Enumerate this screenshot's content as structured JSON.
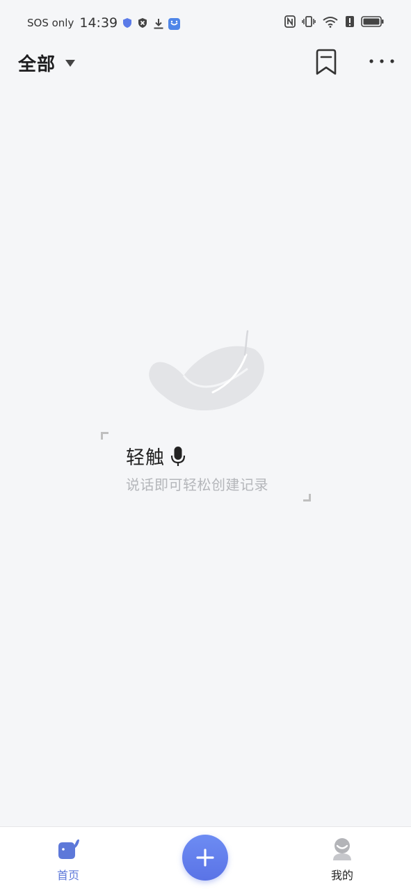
{
  "status_bar": {
    "carrier": "SOS only",
    "time": "14:39",
    "icons": [
      "shield-icon",
      "blocked-icon",
      "download-icon",
      "app-notification-icon",
      "nfc-icon",
      "vibrate-icon",
      "wifi-icon",
      "alert-icon",
      "battery-icon"
    ]
  },
  "header": {
    "filter_label": "全部",
    "icons": [
      "dropdown-caret-icon",
      "bookmark-icon",
      "more-icon"
    ]
  },
  "empty_state": {
    "title": "轻触",
    "subtitle": "说话即可轻松创建记录",
    "icons": [
      "feather-icon",
      "microphone-icon"
    ]
  },
  "bottom_nav": {
    "items": [
      {
        "label": "首页",
        "icon": "whale-icon",
        "active": true
      },
      {
        "label": "我的",
        "icon": "profile-icon",
        "active": false
      }
    ],
    "add_icon": "plus-icon"
  },
  "colors": {
    "background": "#f5f6f8",
    "accent": "#5d78d9",
    "subtitle": "#b4b6ba"
  }
}
